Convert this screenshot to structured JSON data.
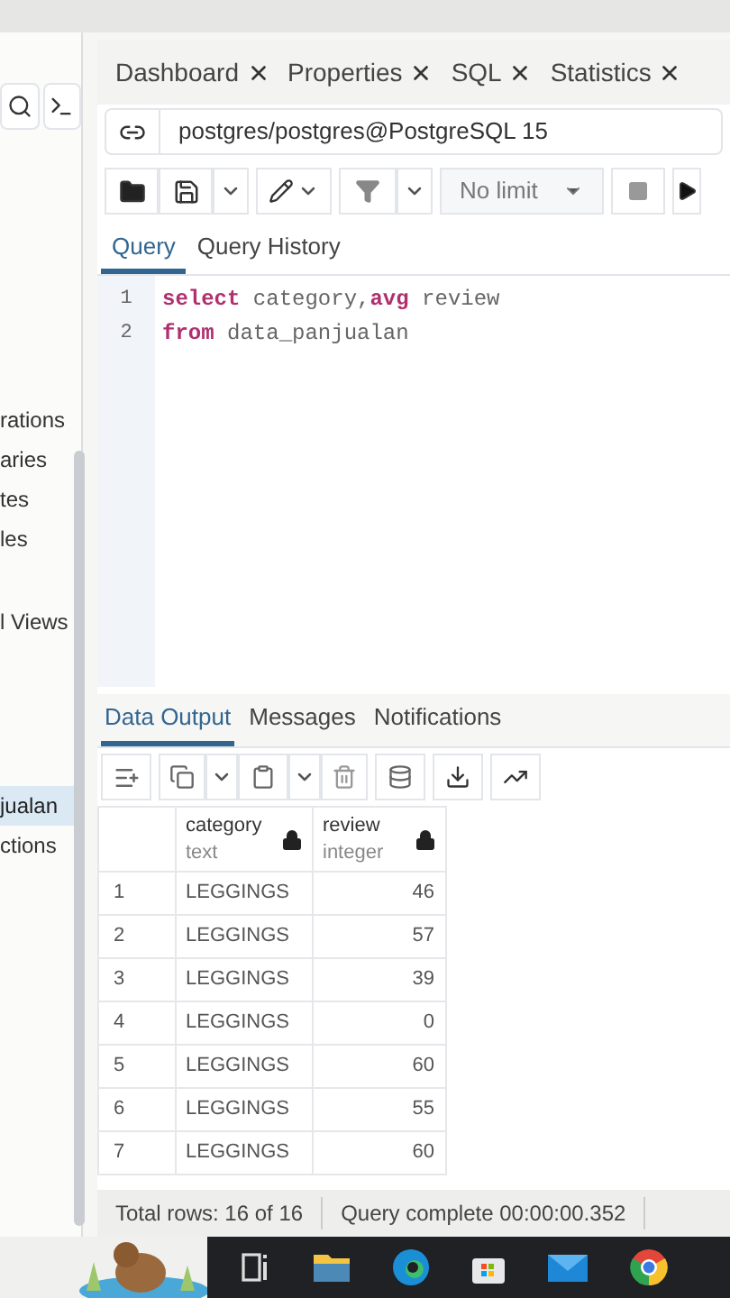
{
  "sidebar": {
    "items": [
      {
        "label": "rations",
        "selected": false
      },
      {
        "label": "aries",
        "selected": false
      },
      {
        "label": "tes",
        "selected": false
      },
      {
        "label": "les",
        "selected": false
      },
      {
        "label": "l Views",
        "selected": false
      },
      {
        "label": "jualan",
        "selected": true
      },
      {
        "label": "ctions",
        "selected": false
      }
    ]
  },
  "tabs": [
    {
      "label": "Dashboard"
    },
    {
      "label": "Properties"
    },
    {
      "label": "SQL"
    },
    {
      "label": "Statistics"
    }
  ],
  "connection": "postgres/postgres@PostgreSQL 15",
  "limit": "No limit",
  "editor_tabs": [
    {
      "label": "Query",
      "selected": true
    },
    {
      "label": "Query History",
      "selected": false
    }
  ],
  "editor": {
    "lines": [
      {
        "number": "1",
        "tokens": [
          {
            "text": "select",
            "kind": "keyword"
          },
          {
            "text": " category,",
            "kind": "plain"
          },
          {
            "text": "avg",
            "kind": "keyword"
          },
          {
            "text": " review",
            "kind": "plain"
          }
        ]
      },
      {
        "number": "2",
        "tokens": [
          {
            "text": "from",
            "kind": "keyword"
          },
          {
            "text": " data_panjualan",
            "kind": "plain"
          }
        ]
      }
    ]
  },
  "output_tabs": [
    {
      "label": "Data Output",
      "selected": true
    },
    {
      "label": "Messages",
      "selected": false
    },
    {
      "label": "Notifications",
      "selected": false
    }
  ],
  "table": {
    "columns": [
      {
        "name": "category",
        "type": "text"
      },
      {
        "name": "review",
        "type": "integer"
      }
    ],
    "rows": [
      {
        "number": "1",
        "category": "LEGGINGS",
        "review": "46"
      },
      {
        "number": "2",
        "category": "LEGGINGS",
        "review": "57"
      },
      {
        "number": "3",
        "category": "LEGGINGS",
        "review": "39"
      },
      {
        "number": "4",
        "category": "LEGGINGS",
        "review": "0"
      },
      {
        "number": "5",
        "category": "LEGGINGS",
        "review": "60"
      },
      {
        "number": "6",
        "category": "LEGGINGS",
        "review": "55"
      },
      {
        "number": "7",
        "category": "LEGGINGS",
        "review": "60"
      }
    ]
  },
  "status_bar": {
    "rows": "Total rows: 16 of 16",
    "query": "Query complete 00:00:00.352"
  }
}
